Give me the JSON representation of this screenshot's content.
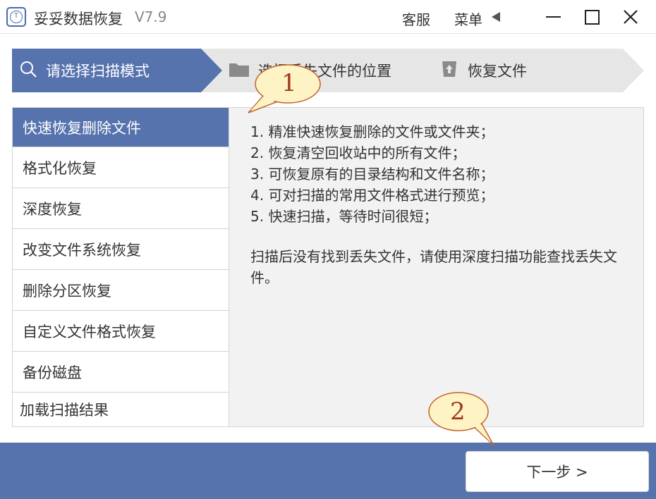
{
  "titlebar": {
    "app_title": "妥妥数据恢复",
    "version": "V7.9",
    "service_label": "客服",
    "menu_label": "菜单"
  },
  "steps": [
    {
      "label": "请选择扫描模式",
      "icon": "search-icon"
    },
    {
      "label": "选择丢失文件的位置",
      "icon": "folder-icon"
    },
    {
      "label": "恢复文件",
      "icon": "upload-icon"
    }
  ],
  "modes": [
    {
      "label": "快速恢复删除文件",
      "selected": true
    },
    {
      "label": "格式化恢复"
    },
    {
      "label": "深度恢复"
    },
    {
      "label": "改变文件系统恢复"
    },
    {
      "label": "删除分区恢复"
    },
    {
      "label": "自定义文件格式恢复"
    },
    {
      "label": "备份磁盘"
    },
    {
      "label": "加载扫描结果"
    }
  ],
  "description": {
    "lines": [
      "1. 精准快速恢复删除的文件或文件夹；",
      "2. 恢复清空回收站中的所有文件；",
      "3. 可恢复原有的目录结构和文件名称；",
      "4. 可对扫描的常用文件格式进行预览；",
      "5. 快速扫描，等待时间很短；"
    ],
    "note": "扫描后没有找到丢失文件，请使用深度扫描功能查找丢失文件。"
  },
  "next_button": {
    "label": "下一步 >"
  },
  "callouts": [
    "1",
    "2"
  ],
  "colors": {
    "accent": "#5673ae",
    "callout_fill": "#fdf3c4",
    "callout_border": "#c2632a"
  }
}
